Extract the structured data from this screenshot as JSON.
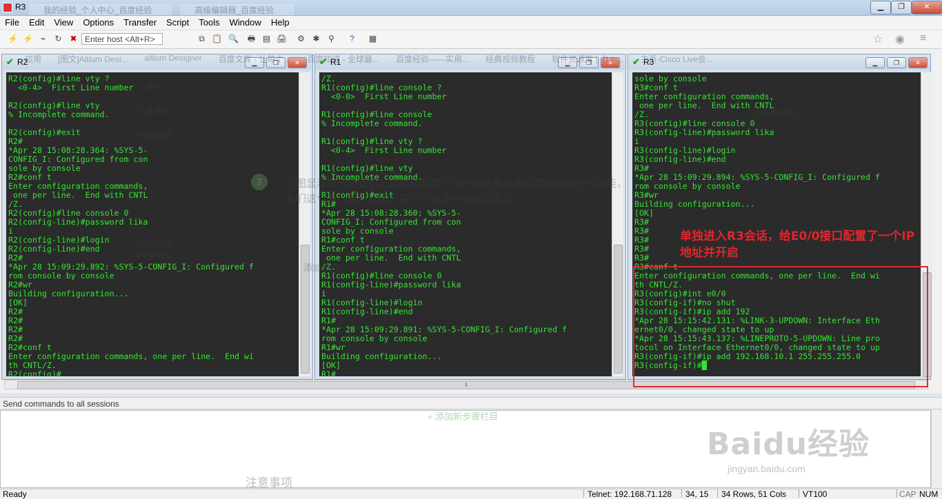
{
  "app": {
    "title": "R3"
  },
  "browser_tabs": [
    "我的经验_个人中心_百度经验",
    "高级编辑器_百度经验"
  ],
  "bookmarks": [
    "应用",
    "[图文]Altium Desi...",
    "altium Designer",
    "百度文库 - 让每个...",
    "百度知道 - 全球最...",
    "百度经验——实用...",
    "经典视频教程",
    "软件资源库 |《Lin...",
    "主页-Cisco Live会..."
  ],
  "menu": [
    "File",
    "Edit",
    "View",
    "Options",
    "Transfer",
    "Script",
    "Tools",
    "Window",
    "Help"
  ],
  "toolbar": {
    "host_placeholder": "Enter host <Alt+R>"
  },
  "sessions": [
    {
      "name": "R2",
      "lines": [
        "R2(config)#line vty ?",
        "  <0-4>  First Line number",
        "",
        "R2(config)#line vty",
        "% Incomplete command.",
        "",
        "R2(config)#exit",
        "R2#",
        "*Apr 28 15:08:28.364: %SYS-5-",
        "CONFIG_I: Configured from con",
        "sole by console",
        "R2#conf t",
        "Enter configuration commands,",
        " one per line.  End with CNTL",
        "/Z.",
        "R2(config)#line console 0",
        "R2(config-line)#password lika",
        "i",
        "R2(config-line)#login",
        "R2(config-line)#end",
        "R2#",
        "*Apr 28 15:09:29.892: %SYS-5-CONFIG_I: Configured f",
        "rom console by console",
        "R2#wr",
        "Building configuration...",
        "[OK]",
        "R2#",
        "R2#",
        "R2#",
        "R2#",
        "R2#conf t",
        "Enter configuration commands, one per line.  End wi",
        "th CNTL/Z.",
        "R2(config)#"
      ]
    },
    {
      "name": "R1",
      "lines": [
        "/Z.",
        "R1(config)#line console ?",
        "  <0-0>  First Line number",
        "",
        "R1(config)#line console",
        "% Incomplete command.",
        "",
        "R1(config)#line vty ?",
        "  <0-4>  First Line number",
        "",
        "R1(config)#line vty",
        "% Incomplete command.",
        "",
        "R1(config)#exit",
        "R1#",
        "*Apr 28 15:08:28.360: %SYS-5-",
        "CONFIG_I: Configured from con",
        "sole by console",
        "R1#conf t",
        "Enter configuration commands,",
        " one per line.  End with CNTL",
        "/Z.",
        "R1(config)#line console 0",
        "R1(config-line)#password lika",
        "i",
        "R1(config-line)#login",
        "R1(config-line)#end",
        "R1#",
        "*Apr 28 15:09:29.891: %SYS-5-CONFIG_I: Configured f",
        "rom console by console",
        "R1#wr",
        "Building configuration...",
        "[OK]",
        "R1#"
      ]
    },
    {
      "name": "R3",
      "lines": [
        "sole by console",
        "R3#conf t",
        "Enter configuration commands,",
        " one per line.  End with CNTL",
        "/Z.",
        "R3(config)#line console 0",
        "R3(config-line)#password lika",
        "i",
        "R3(config-line)#login",
        "R3(config-line)#end",
        "R3#",
        "*Apr 28 15:09:29.894: %SYS-5-CONFIG_I: Configured f",
        "rom console by console",
        "R3#wr",
        "Building configuration...",
        "[OK]",
        "R3#",
        "R3#",
        "R3#",
        "R3#",
        "R3#",
        "R3#conf t",
        "Enter configuration commands, one per line.  End wi",
        "th CNTL/Z.",
        "R3(config)#int e0/0",
        "R3(config-if)#no shut",
        "R3(config-if)#ip add 192",
        "*Apr 28 15:15:42.131: %LINK-3-UPDOWN: Interface Eth",
        "ernet0/0, changed state to up",
        "*Apr 28 15:15:43.137: %LINEPROTO-5-UPDOWN: Line pro",
        "tocol on Interface Ethernet0/0, changed state to up",
        "R3(config-if)#ip add 192.168.10.1 255.255.255.0"
      ],
      "prompt": "R3(config-if)#"
    }
  ],
  "send_bar": {
    "label": "Send commands to all sessions"
  },
  "status": {
    "ready": "Ready",
    "connection": "Telnet: 192.168.71.128",
    "cursor_pos": "34,  15",
    "size": "34 Rows, 51 Cols",
    "terminal": "VT100",
    "caps": "CAP",
    "num": "NUM"
  },
  "annotation": {
    "text": "单独进入R3会话，给E0/0接口配置了一个IP地址并开启"
  },
  "background_page": {
    "step_number": "7",
    "step_text": "上图显示就代表我们已经成功配置了同时给所有设备配置相同命令的功能，我们这个窗口也可以进入某一个会话中单独配置的。",
    "sidebar": [
      "简介",
      "工具/原料",
      "方法/步骤",
      "写优质经验领丰厚奖金"
    ],
    "add_image": "点击添加图片",
    "add_step": "+ 添加新步骤栏目",
    "notes_heading": "注意事项",
    "fragments": [
      "添加引用",
      "添加",
      "添加"
    ]
  },
  "watermark": {
    "brand": "Baidu经验",
    "url": "jingyan.baidu.com"
  }
}
